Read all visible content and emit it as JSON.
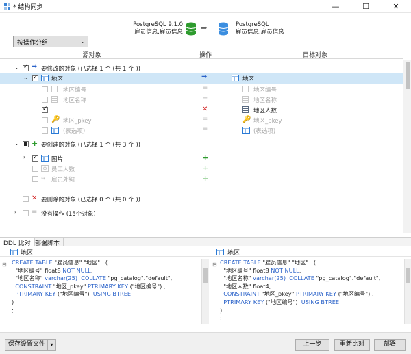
{
  "window": {
    "title": "* 结构同步",
    "min_glyph": "—",
    "max_glyph": "☐",
    "close_glyph": "✕"
  },
  "header": {
    "source_db": "PostgreSQL 9.1.0",
    "source_table": "雇员信息.雇员信息",
    "target_db": "PostgreSQL",
    "target_table": "雇员信息.雇员信息",
    "arrow": "➡",
    "group_select": "按操作分组"
  },
  "columns": {
    "source": "源对象",
    "action": "操作",
    "target": "目标对象"
  },
  "groups": {
    "modify": {
      "label": "要修改的对象 (已选择 1 个 (共 1 个 ))"
    },
    "create": {
      "label": "要创建的对象 (已选择 1 个 (共 3 个 ))"
    },
    "delete": {
      "label": "要删除的对象 (已选择 0 个 (共 0 个 ))"
    },
    "none": {
      "label": "没有操作 (15个对象)"
    }
  },
  "modify_rows": {
    "table": {
      "src": "地区",
      "tgt": "地区"
    },
    "c1": {
      "src": "地区编号",
      "tgt": "地区编号",
      "op": "="
    },
    "c2": {
      "src": "地区名称",
      "tgt": "地区名称",
      "op": "="
    },
    "c3": {
      "src": "",
      "tgt": "地区人数",
      "op": "✕"
    },
    "c4": {
      "src": "地区_pkey",
      "tgt": "地区_pkey",
      "op": "="
    },
    "c5": {
      "src": "(表选项)",
      "tgt": "(表选项)",
      "op": "="
    }
  },
  "create_rows": {
    "r1": {
      "src": "图片",
      "op": "+"
    },
    "r2": {
      "src": "员工人数",
      "op": "+"
    },
    "r3": {
      "src": "雇员外键",
      "op": "+"
    }
  },
  "tabs": {
    "ddl": "DDL 比对",
    "deploy": "部署脚本"
  },
  "ddl_left": {
    "title": "地区",
    "lines": [
      [
        {
          "t": "CREATE TABLE ",
          "c": "kw"
        },
        {
          "t": "\"雇员信息\".\"地区\"   (",
          "c": ""
        }
      ],
      [
        {
          "t": "  \"地区编号\" float8 ",
          "c": ""
        },
        {
          "t": "NOT NULL",
          "c": "kw"
        },
        {
          "t": ",",
          "c": ""
        }
      ],
      [
        {
          "t": "  \"地区名称\" ",
          "c": ""
        },
        {
          "t": "varchar(25)",
          "c": "kw"
        },
        {
          "t": "  ",
          "c": ""
        },
        {
          "t": "COLLATE",
          "c": "kw"
        },
        {
          "t": " \"pg_catalog\".\"default\",",
          "c": ""
        }
      ],
      [
        {
          "t": "  ",
          "c": ""
        },
        {
          "t": "CONSTRAINT",
          "c": "kw"
        },
        {
          "t": " \"地区_pkey\" ",
          "c": ""
        },
        {
          "t": "PTRIMARY KEY",
          "c": "kw"
        },
        {
          "t": " (\"地区编号\") ,",
          "c": ""
        }
      ],
      [
        {
          "t": "  ",
          "c": ""
        },
        {
          "t": "PTRIMARY KEY",
          "c": "kw"
        },
        {
          "t": " (\"地区编号\")  ",
          "c": ""
        },
        {
          "t": "USING BTREE",
          "c": "kw"
        }
      ],
      [
        {
          "t": ")",
          "c": ""
        }
      ],
      [
        {
          "t": ";",
          "c": ""
        }
      ]
    ]
  },
  "ddl_right": {
    "title": "地区",
    "lines": [
      [
        {
          "t": "CREATE TABLE ",
          "c": "kw"
        },
        {
          "t": "\"雇员信息\".\"地区\"   (",
          "c": ""
        }
      ],
      [
        {
          "t": "  \"地区编号\" float8 ",
          "c": ""
        },
        {
          "t": "NOT NULL",
          "c": "kw"
        },
        {
          "t": ",",
          "c": ""
        }
      ],
      [
        {
          "t": "  \"地区名称\" ",
          "c": ""
        },
        {
          "t": "varchar(25)",
          "c": "kw"
        },
        {
          "t": "  ",
          "c": ""
        },
        {
          "t": "COLLATE",
          "c": "kw"
        },
        {
          "t": " \"pg_catalog\".\"default\",",
          "c": ""
        }
      ],
      [
        {
          "t": "  \"地区人数\" float4,",
          "c": ""
        }
      ],
      [
        {
          "t": "  ",
          "c": ""
        },
        {
          "t": "CONSTRAINT",
          "c": "kw"
        },
        {
          "t": " \"地区_pkey\" ",
          "c": ""
        },
        {
          "t": "PTRIMARY KEY",
          "c": "kw"
        },
        {
          "t": " (\"地区编号\") ,",
          "c": ""
        }
      ],
      [
        {
          "t": "  ",
          "c": ""
        },
        {
          "t": "PTRIMARY KEY",
          "c": "kw"
        },
        {
          "t": " (\"地区编号\")  ",
          "c": ""
        },
        {
          "t": "USING BTREE",
          "c": "kw"
        }
      ],
      [
        {
          "t": ")",
          "c": ""
        }
      ],
      [
        {
          "t": ";",
          "c": ""
        }
      ]
    ]
  },
  "footer": {
    "save": "保存设置文件",
    "prev": "上一步",
    "recompare": "重新比对",
    "deploy": "部署"
  },
  "colors": {
    "accent": "#2a62c9",
    "add": "#2e9b2e",
    "remove": "#d21e1e",
    "selection": "#cfe6f7"
  }
}
